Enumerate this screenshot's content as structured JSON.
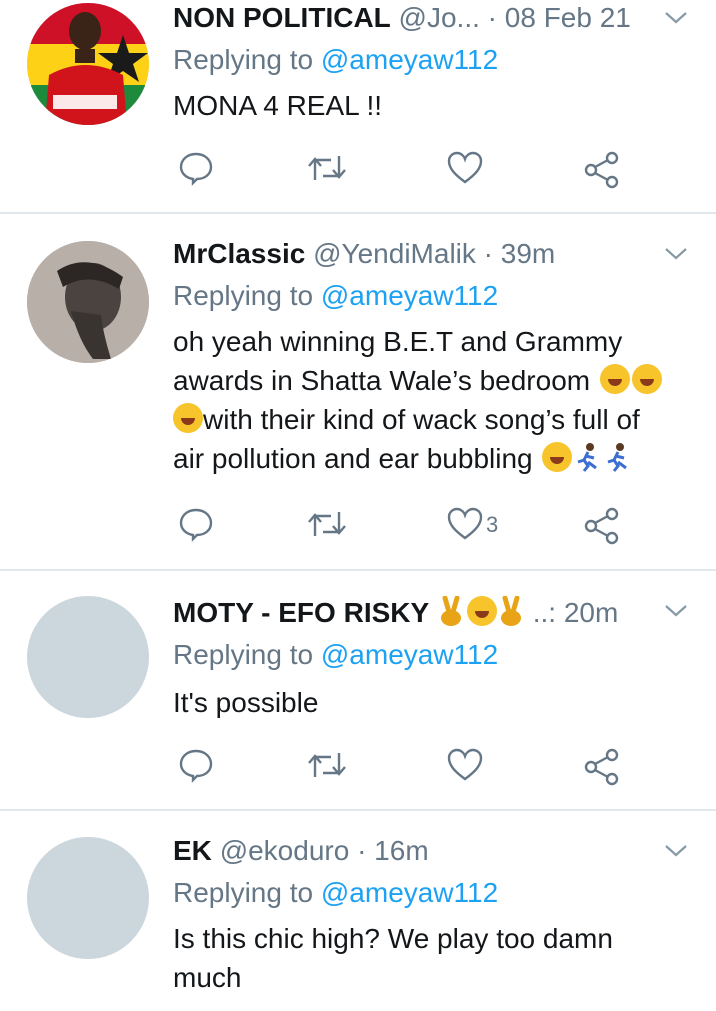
{
  "replying_prefix": "Replying to",
  "tweets": [
    {
      "name": "NON POLITICAL",
      "handle": "@Jo...",
      "time": "· 08 Feb 21",
      "reply_to": "@ameyaw112",
      "text": "MONA 4 REAL !!",
      "likes": ""
    },
    {
      "name": "MrClassic",
      "handle": "@YendiMalik",
      "time": "· 39m",
      "reply_to": "@ameyaw112",
      "lines": [
        "oh yeah winning B.E.T and Grammy",
        "awards in Shatta Wale’s bedroom",
        "with their kind of wack song’s full of",
        "air pollution and ear bubbling"
      ],
      "likes": "3"
    },
    {
      "name": "MOTY - EFO RISKY",
      "handle": "",
      "time": "..: 20m",
      "reply_to": "@ameyaw112",
      "text": "It's possible",
      "likes": ""
    },
    {
      "name": "EK",
      "handle": "@ekoduro",
      "time": "· 16m",
      "reply_to": "@ameyaw112",
      "lines": [
        "Is this chic high? We play too damn",
        "much"
      ]
    }
  ],
  "icons": {
    "reply": "reply-icon",
    "retweet": "retweet-icon",
    "like": "heart-icon",
    "share": "share-icon",
    "more": "chevron-down-icon"
  },
  "colors": {
    "link": "#1da1f2",
    "muted": "#657786",
    "text": "#14171a",
    "divider": "#e1e8ed"
  }
}
